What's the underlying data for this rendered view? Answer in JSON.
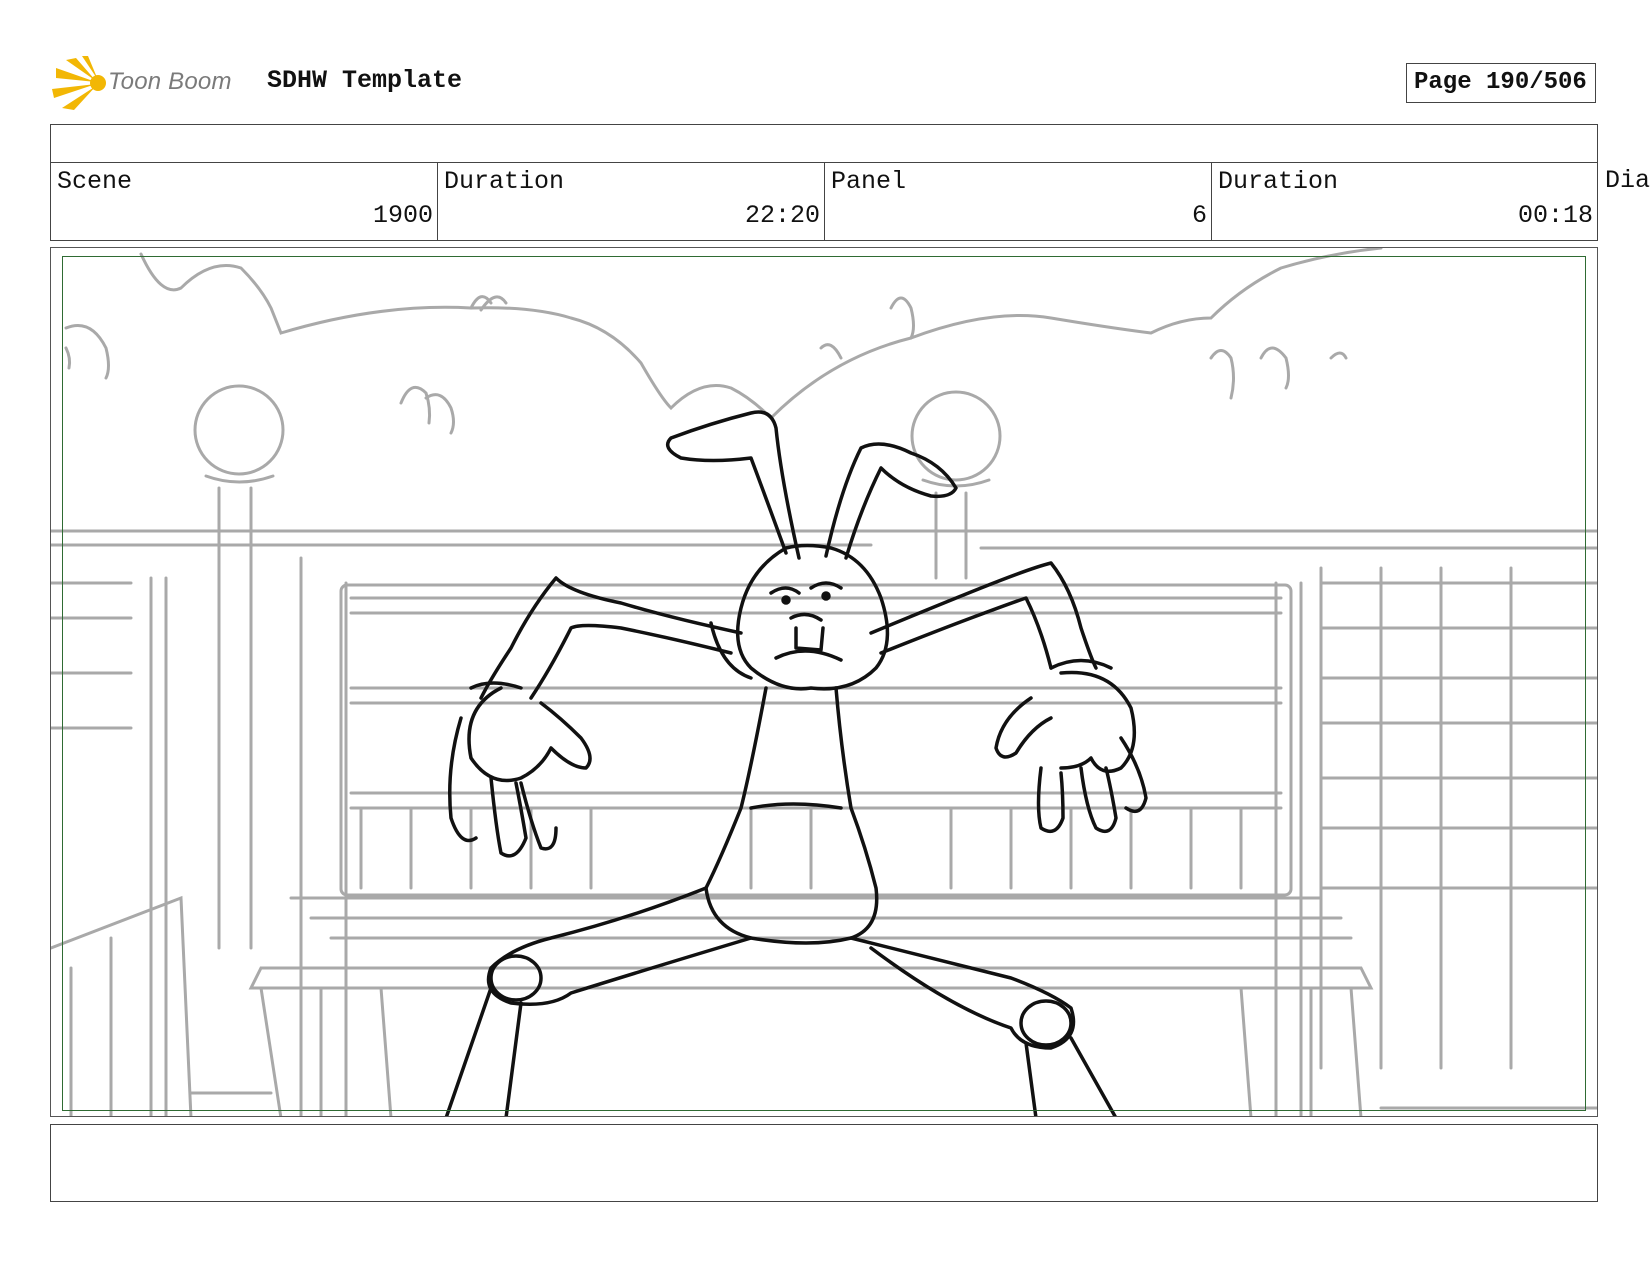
{
  "header": {
    "logo_text": "Toon Boom",
    "title": "SDHW Template",
    "page": "Page 190/506"
  },
  "info": {
    "scene_label": "Scene",
    "scene_value": "1900",
    "scene_duration_label": "Duration",
    "scene_duration_value": "22:20",
    "panel_label": "Panel",
    "panel_value": "6",
    "panel_duration_label": "Duration",
    "panel_duration_value": "00:18",
    "dialogue_label": "Dia"
  },
  "colors": {
    "logo_yellow": "#f2b705",
    "safe_frame": "#2f6b33",
    "background_sketch": "#a9a9a9",
    "character_ink": "#111111"
  },
  "icons": [
    "toon-boom-logo-icon"
  ]
}
